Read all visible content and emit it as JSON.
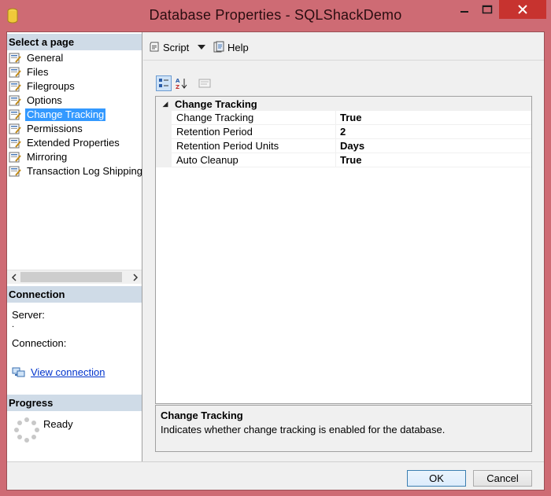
{
  "window": {
    "title": "Database Properties - SQLShackDemo"
  },
  "sidebar": {
    "select_page_header": "Select a page",
    "pages": [
      {
        "label": "General",
        "icon": "page-wrench-icon"
      },
      {
        "label": "Files",
        "icon": "page-wrench-icon"
      },
      {
        "label": "Filegroups",
        "icon": "page-wrench-icon"
      },
      {
        "label": "Options",
        "icon": "page-wrench-icon"
      },
      {
        "label": "Change Tracking",
        "icon": "page-wrench-icon",
        "selected": true
      },
      {
        "label": "Permissions",
        "icon": "page-wrench-icon"
      },
      {
        "label": "Extended Properties",
        "icon": "page-wrench-icon"
      },
      {
        "label": "Mirroring",
        "icon": "page-wrench-icon"
      },
      {
        "label": "Transaction Log Shipping",
        "icon": "page-wrench-icon"
      }
    ],
    "connection_header": "Connection",
    "server_label": "Server:",
    "server_value": ".",
    "connection_label": "Connection:",
    "view_connection_link": "View connection",
    "progress_header": "Progress",
    "progress_status": "Ready"
  },
  "toolbar": {
    "script_label": "Script",
    "help_label": "Help"
  },
  "property_grid": {
    "category": "Change Tracking",
    "rows": [
      {
        "name": "Change Tracking",
        "value": "True"
      },
      {
        "name": "Retention Period",
        "value": "2"
      },
      {
        "name": "Retention Period Units",
        "value": "Days"
      },
      {
        "name": "Auto Cleanup",
        "value": "True"
      }
    ]
  },
  "description": {
    "title": "Change Tracking",
    "text": "Indicates whether change tracking is enabled for the database."
  },
  "buttons": {
    "ok": "OK",
    "cancel": "Cancel"
  },
  "colors": {
    "title_bar": "#ce6b74",
    "close_button": "#c7332f",
    "selection": "#3399ff",
    "section_header": "#cfdbe7",
    "link": "#0033cc"
  }
}
